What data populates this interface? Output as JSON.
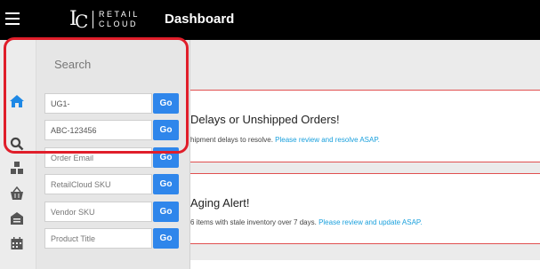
{
  "header": {
    "logo_text_line1": "RETAIL",
    "logo_text_line2": "CLOUD",
    "title": "Dashboard",
    "icons": [
      "menu-icon",
      "retailcloud-logo"
    ]
  },
  "rail": {
    "items": [
      {
        "icon": "home-icon",
        "active": true
      },
      {
        "icon": "search-icon",
        "active": false
      },
      {
        "icon": "inventory-icon",
        "active": false
      },
      {
        "icon": "basket-icon",
        "active": false
      },
      {
        "icon": "warehouse-icon",
        "active": false
      },
      {
        "icon": "calendar-icon",
        "active": false
      }
    ]
  },
  "search_panel": {
    "title": "Search",
    "fields": [
      {
        "value": "UG1-",
        "placeholder": "",
        "button": "Go"
      },
      {
        "value": "ABC-123456",
        "placeholder": "",
        "button": "Go"
      },
      {
        "value": "",
        "placeholder": "Order Email",
        "button": "Go"
      },
      {
        "value": "",
        "placeholder": "RetailCloud SKU",
        "button": "Go"
      },
      {
        "value": "",
        "placeholder": "Vendor SKU",
        "button": "Go"
      },
      {
        "value": "",
        "placeholder": "Product Title",
        "button": "Go"
      }
    ]
  },
  "alerts": [
    {
      "title": "Delays or Unshipped Orders!",
      "desc": "hipment delays to resolve. ",
      "link": "Please review and resolve ASAP."
    },
    {
      "title": "Aging Alert!",
      "desc": "6 items with stale inventory over 7 days. ",
      "link": "Please review and update ASAP."
    }
  ],
  "colors": {
    "accent": "#2f86eb",
    "alert_border": "#e05050",
    "highlight": "#e01e2a",
    "link": "#1aa0dd"
  }
}
